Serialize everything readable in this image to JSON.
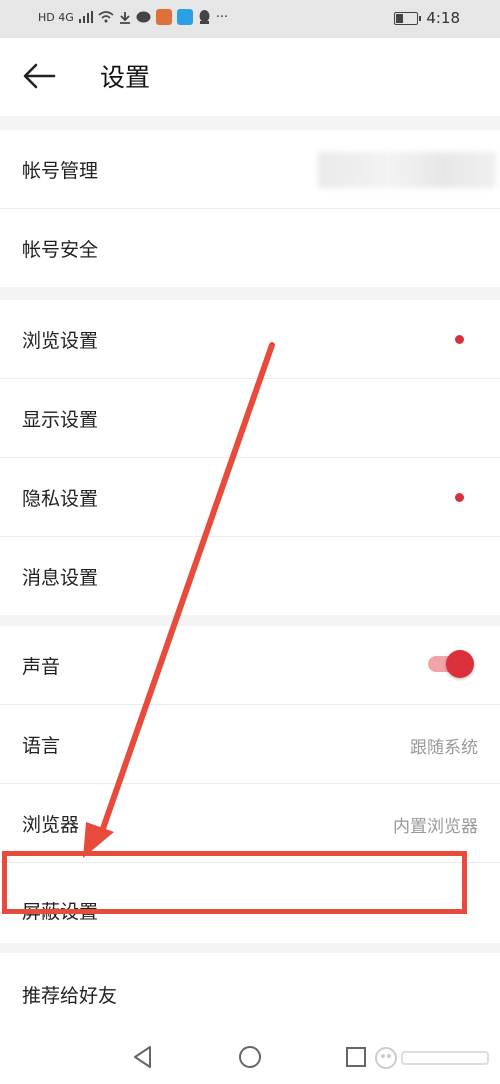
{
  "status_bar": {
    "network_label": "HD 4G",
    "time": "4:18"
  },
  "header": {
    "title": "设置"
  },
  "groups": [
    {
      "items": [
        {
          "label": "帐号管理"
        },
        {
          "label": "帐号安全"
        }
      ]
    },
    {
      "items": [
        {
          "label": "浏览设置",
          "badge": "red-dot"
        },
        {
          "label": "显示设置"
        },
        {
          "label": "隐私设置",
          "badge": "red-dot"
        },
        {
          "label": "消息设置"
        }
      ]
    },
    {
      "items": [
        {
          "label": "声音",
          "toggle_on": true
        },
        {
          "label": "语言",
          "value": "跟随系统"
        },
        {
          "label": "浏览器",
          "value": "内置浏览器"
        },
        {
          "label": "屏蔽设置"
        }
      ]
    },
    {
      "items": [
        {
          "label": "推荐给好友"
        }
      ]
    }
  ],
  "navigation": [
    "back-triangle-icon",
    "home-circle-icon",
    "recents-square-icon"
  ],
  "colors": {
    "accent": "#d9303c",
    "annotation": "#e84a3c"
  }
}
